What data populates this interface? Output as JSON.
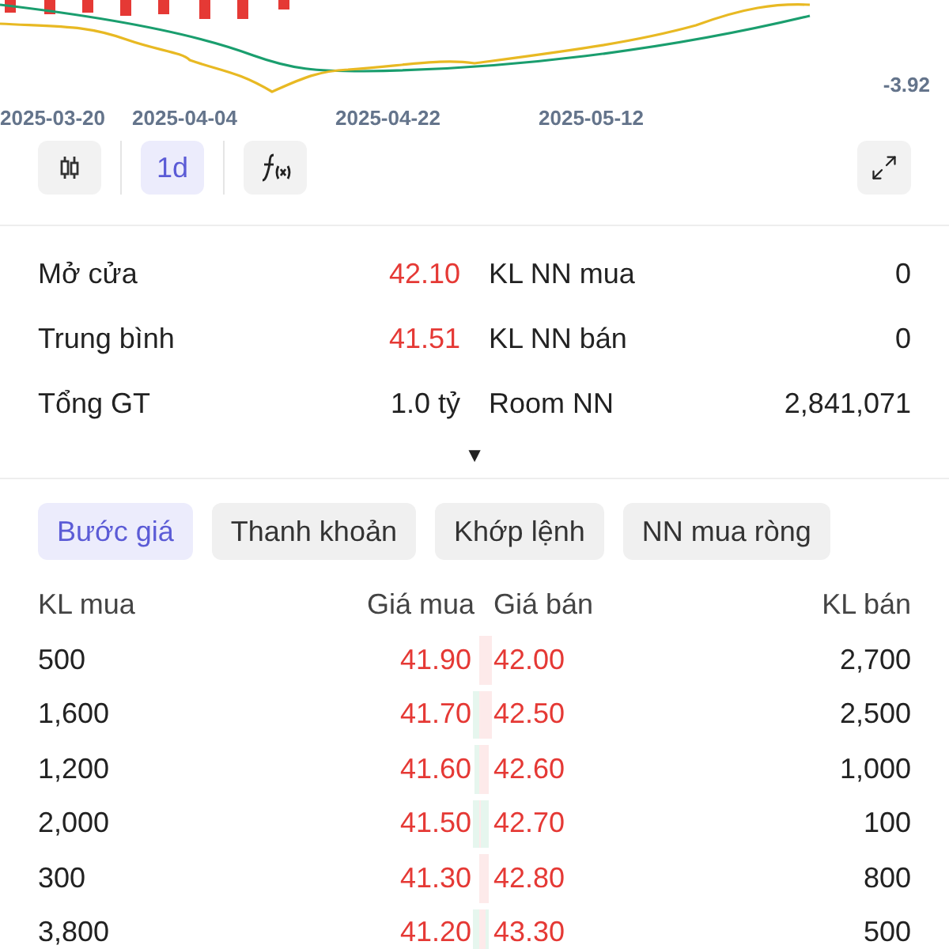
{
  "chart": {
    "value_label": "-3.92",
    "dates": [
      "2025-03-20",
      "2025-04-04",
      "2025-04-22",
      "2025-05-12"
    ]
  },
  "toolbar": [
    {
      "kind": "candles"
    },
    {
      "kind": "interval",
      "label": "1d"
    },
    {
      "kind": "formula"
    }
  ],
  "stats": [
    {
      "label": "Mở cửa",
      "value": "42.10",
      "kind": "price"
    },
    {
      "label": "KL NN mua",
      "value": "0",
      "kind": "plain"
    },
    {
      "label": "Trung bình",
      "value": "41.51",
      "kind": "price"
    },
    {
      "label": "KL NN bán",
      "value": "0",
      "kind": "plain"
    },
    {
      "label": "Tổng GT",
      "value": "1.0 tỷ",
      "kind": "plain"
    },
    {
      "label": "Room NN",
      "value": "2,841,071",
      "kind": "plain"
    }
  ],
  "expand_toggle": "▼",
  "tabs": [
    {
      "label": "Bước giá",
      "selected": true
    },
    {
      "label": "Thanh khoản",
      "selected": false
    },
    {
      "label": "Khớp lệnh",
      "selected": false
    },
    {
      "label": "NN mua ròng",
      "selected": false
    }
  ],
  "order_book": {
    "columns": [
      "KL mua",
      "Giá mua",
      "Giá bán",
      "KL bán"
    ],
    "rows": [
      {
        "bid_volume": "500",
        "bid_price": "41.90",
        "ask_price": "42.00",
        "ask_volume": "2,700"
      },
      {
        "bid_volume": "1,600",
        "bid_price": "41.70",
        "ask_price": "42.50",
        "ask_volume": "2,500"
      },
      {
        "bid_volume": "1,200",
        "bid_price": "41.60",
        "ask_price": "42.60",
        "ask_volume": "1,000"
      },
      {
        "bid_volume": "2,000",
        "bid_price": "41.50",
        "ask_price": "42.70",
        "ask_volume": "100"
      },
      {
        "bid_volume": "300",
        "bid_price": "41.30",
        "ask_price": "42.80",
        "ask_volume": "800"
      },
      {
        "bid_volume": "3,800",
        "bid_price": "41.20",
        "ask_price": "43.30",
        "ask_volume": "500"
      }
    ]
  }
}
